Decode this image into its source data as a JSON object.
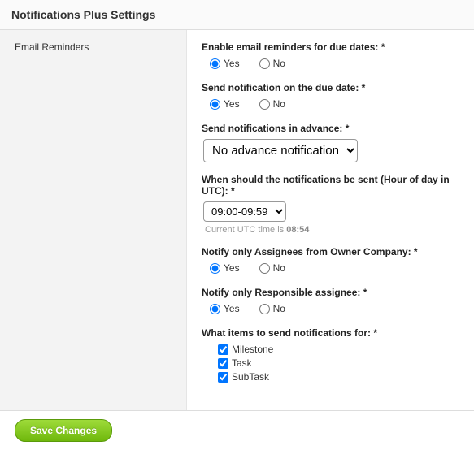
{
  "header": {
    "title": "Notifications Plus Settings"
  },
  "sidebar": {
    "label": "Email Reminders"
  },
  "form": {
    "enable": {
      "label": "Enable email reminders for due dates: *",
      "yes": "Yes",
      "no": "No",
      "value": "yes"
    },
    "dueDate": {
      "label": "Send notification on the due date: *",
      "yes": "Yes",
      "no": "No",
      "value": "yes"
    },
    "advance": {
      "label": "Send notifications in advance: *",
      "selected": "No advance notification"
    },
    "hour": {
      "label": "When should the notifications be sent (Hour of day in UTC): *",
      "selected": "09:00-09:59",
      "hintPrefix": "Current UTC time is ",
      "hintTime": "08:54"
    },
    "ownerOnly": {
      "label": "Notify only Assignees from Owner Company: *",
      "yes": "Yes",
      "no": "No",
      "value": "yes"
    },
    "responsibleOnly": {
      "label": "Notify only Responsible assignee: *",
      "yes": "Yes",
      "no": "No",
      "value": "yes"
    },
    "items": {
      "label": "What items to send notifications for: *",
      "milestone": "Milestone",
      "task": "Task",
      "subtask": "SubTask"
    }
  },
  "footer": {
    "save": "Save Changes"
  }
}
